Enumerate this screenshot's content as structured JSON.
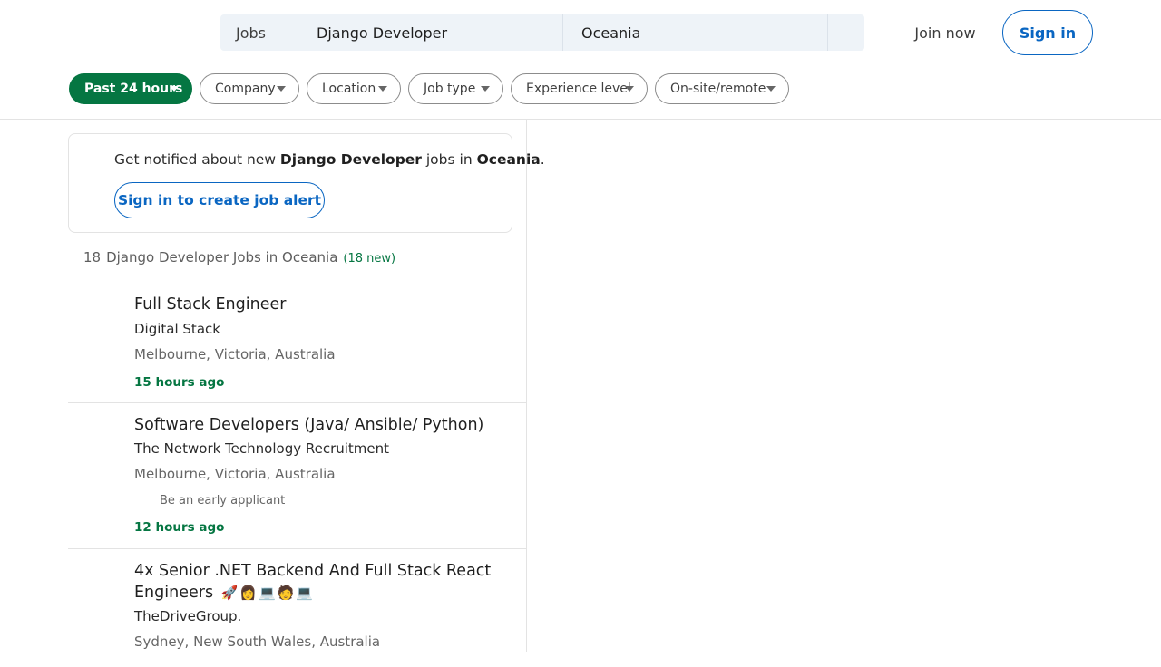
{
  "search": {
    "jobs_label": "Jobs",
    "keywords": "Django Developer",
    "location": "Oceania"
  },
  "nav": {
    "join_now": "Join now",
    "sign_in": "Sign in"
  },
  "filters": [
    {
      "label": "Past 24 hours",
      "active": true
    },
    {
      "label": "Company",
      "active": false
    },
    {
      "label": "Location",
      "active": false
    },
    {
      "label": "Job type",
      "active": false
    },
    {
      "label": "Experience level",
      "active": false
    },
    {
      "label": "On-site/remote",
      "active": false
    }
  ],
  "alert": {
    "prefix": "Get notified about new ",
    "keyword": "Django Developer",
    "middle": " jobs in ",
    "location": "Oceania",
    "suffix": ".",
    "button": "Sign in to create job alert"
  },
  "results": {
    "count": "18",
    "label": "Django Developer Jobs in Oceania",
    "new_label": "(18 new)"
  },
  "jobs": [
    {
      "title": "Full Stack Engineer",
      "company": "Digital Stack",
      "location": "Melbourne, Victoria, Australia",
      "badge": "",
      "posted": "15 hours ago"
    },
    {
      "title": "Software Developers (Java/ Ansible/ Python)",
      "company": "The Network Technology Recruitment",
      "location": "Melbourne, Victoria, Australia",
      "badge": "Be an early applicant",
      "posted": "12 hours ago"
    },
    {
      "title": "4x Senior .NET Backend And Full Stack React Engineers",
      "title_emoji": "🚀👩💻🧑💻",
      "company": "TheDriveGroup.",
      "location": "Sydney, New South Wales, Australia",
      "badge": "",
      "posted": ""
    }
  ],
  "colors": {
    "accent_blue": "#0a66c2",
    "active_green": "#057642",
    "search_bg": "#eef3f8"
  }
}
